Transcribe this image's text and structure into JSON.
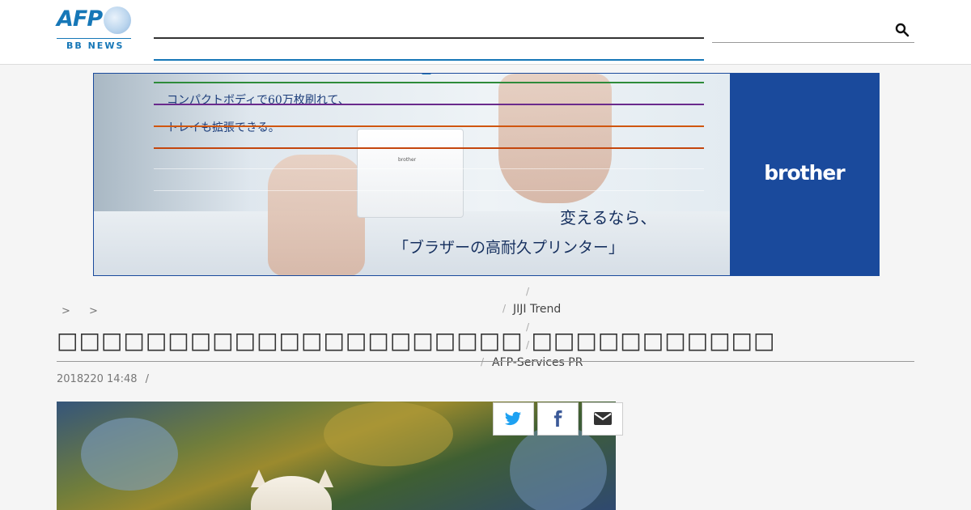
{
  "header": {
    "logo_text": "AFP",
    "logo_sub": "BB NEWS",
    "search_icon": "search-icon"
  },
  "ad": {
    "copy_line1": "コンパクトボディで60万枚刷れて、",
    "copy_line2": "トレイも拡張できる。",
    "printer_brand": "brother",
    "tagline_line1": "変えるなら、",
    "tagline_line2": "「ブラザーの高耐久プリンター」",
    "brand_logo": "brother",
    "colors": {
      "brand": "#1a4a9c"
    }
  },
  "nav": {
    "item1": "JIJI Trend",
    "item2": "AFP-Services PR",
    "separator": "/",
    "dash": "—"
  },
  "breadcrumb": {
    "sep": ">"
  },
  "article": {
    "title": "□□□□□□□□□□□□□□□□□□□□□ □□□□□□□□□□□",
    "date": "2018220 14:48",
    "date_sep": "/"
  },
  "share": {
    "twitter_icon": "twitter-icon",
    "facebook_icon": "facebook-icon",
    "mail_icon": "mail-icon"
  }
}
